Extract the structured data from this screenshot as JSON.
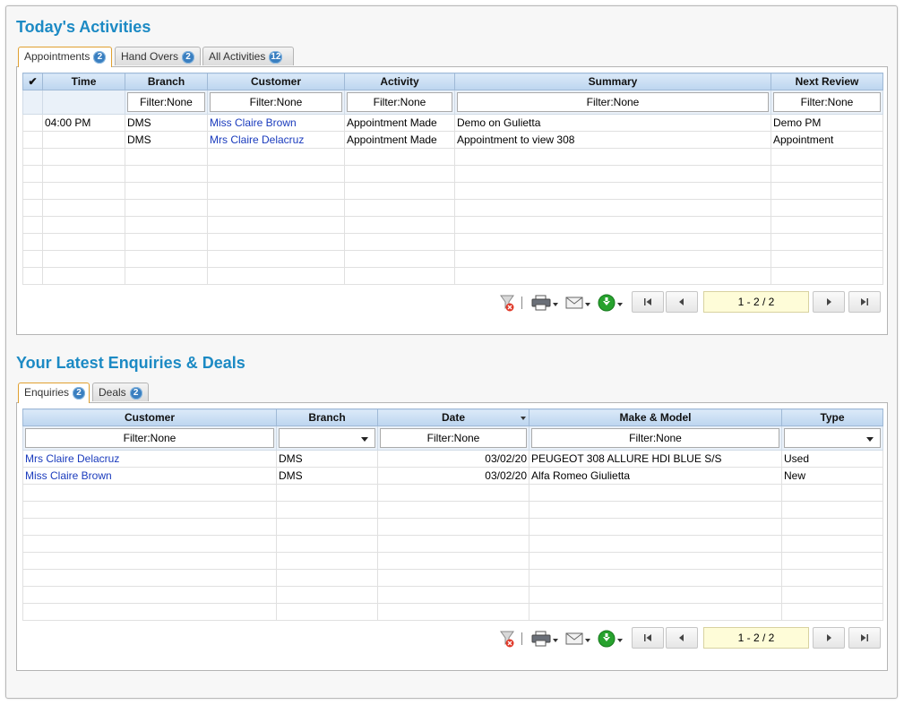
{
  "activities": {
    "title": "Today's Activities",
    "tabs": [
      {
        "label": "Appointments",
        "count": "2"
      },
      {
        "label": "Hand Overs",
        "count": "2"
      },
      {
        "label": "All Activities",
        "count": "12"
      }
    ],
    "columns": [
      "✔",
      "Time",
      "Branch",
      "Customer",
      "Activity",
      "Summary",
      "Next Review"
    ],
    "filter_text": "Filter:None",
    "rows": [
      {
        "time": "04:00 PM",
        "branch": "DMS",
        "customer": "Miss Claire Brown",
        "activity": "Appointment Made",
        "summary": "Demo on Gulietta",
        "next_review": "Demo PM"
      },
      {
        "time": "",
        "branch": "DMS",
        "customer": "Mrs Claire Delacruz",
        "activity": "Appointment Made",
        "summary": "Appointment to view 308",
        "next_review": "Appointment"
      }
    ],
    "page_indicator": "1 - 2 / 2"
  },
  "enquiries": {
    "title": "Your Latest Enquiries & Deals",
    "tabs": [
      {
        "label": "Enquiries",
        "count": "2"
      },
      {
        "label": "Deals",
        "count": "2"
      }
    ],
    "columns": [
      "Customer",
      "Branch",
      "Date",
      "Make & Model",
      "Type"
    ],
    "filter_text": "Filter:None",
    "rows": [
      {
        "customer": "Mrs Claire Delacruz",
        "branch": "DMS",
        "date": "03/02/20",
        "make_model": "PEUGEOT 308 ALLURE HDI BLUE S/S",
        "type": "Used"
      },
      {
        "customer": "Miss Claire Brown",
        "branch": "DMS",
        "date": "03/02/20",
        "make_model": "Alfa Romeo Giulietta",
        "type": "New"
      }
    ],
    "page_indicator": "1 - 2 / 2"
  },
  "icons": [
    "clear-filter-icon",
    "print-icon",
    "email-icon",
    "download-icon",
    "first-page-icon",
    "prev-page-icon",
    "next-page-icon",
    "last-page-icon"
  ],
  "colors": {
    "title": "#1c8ac4",
    "link": "#1a3bbd",
    "badge": "#3a7fc0",
    "download": "#27a22e",
    "page_indicator_bg": "#fefcd8"
  }
}
